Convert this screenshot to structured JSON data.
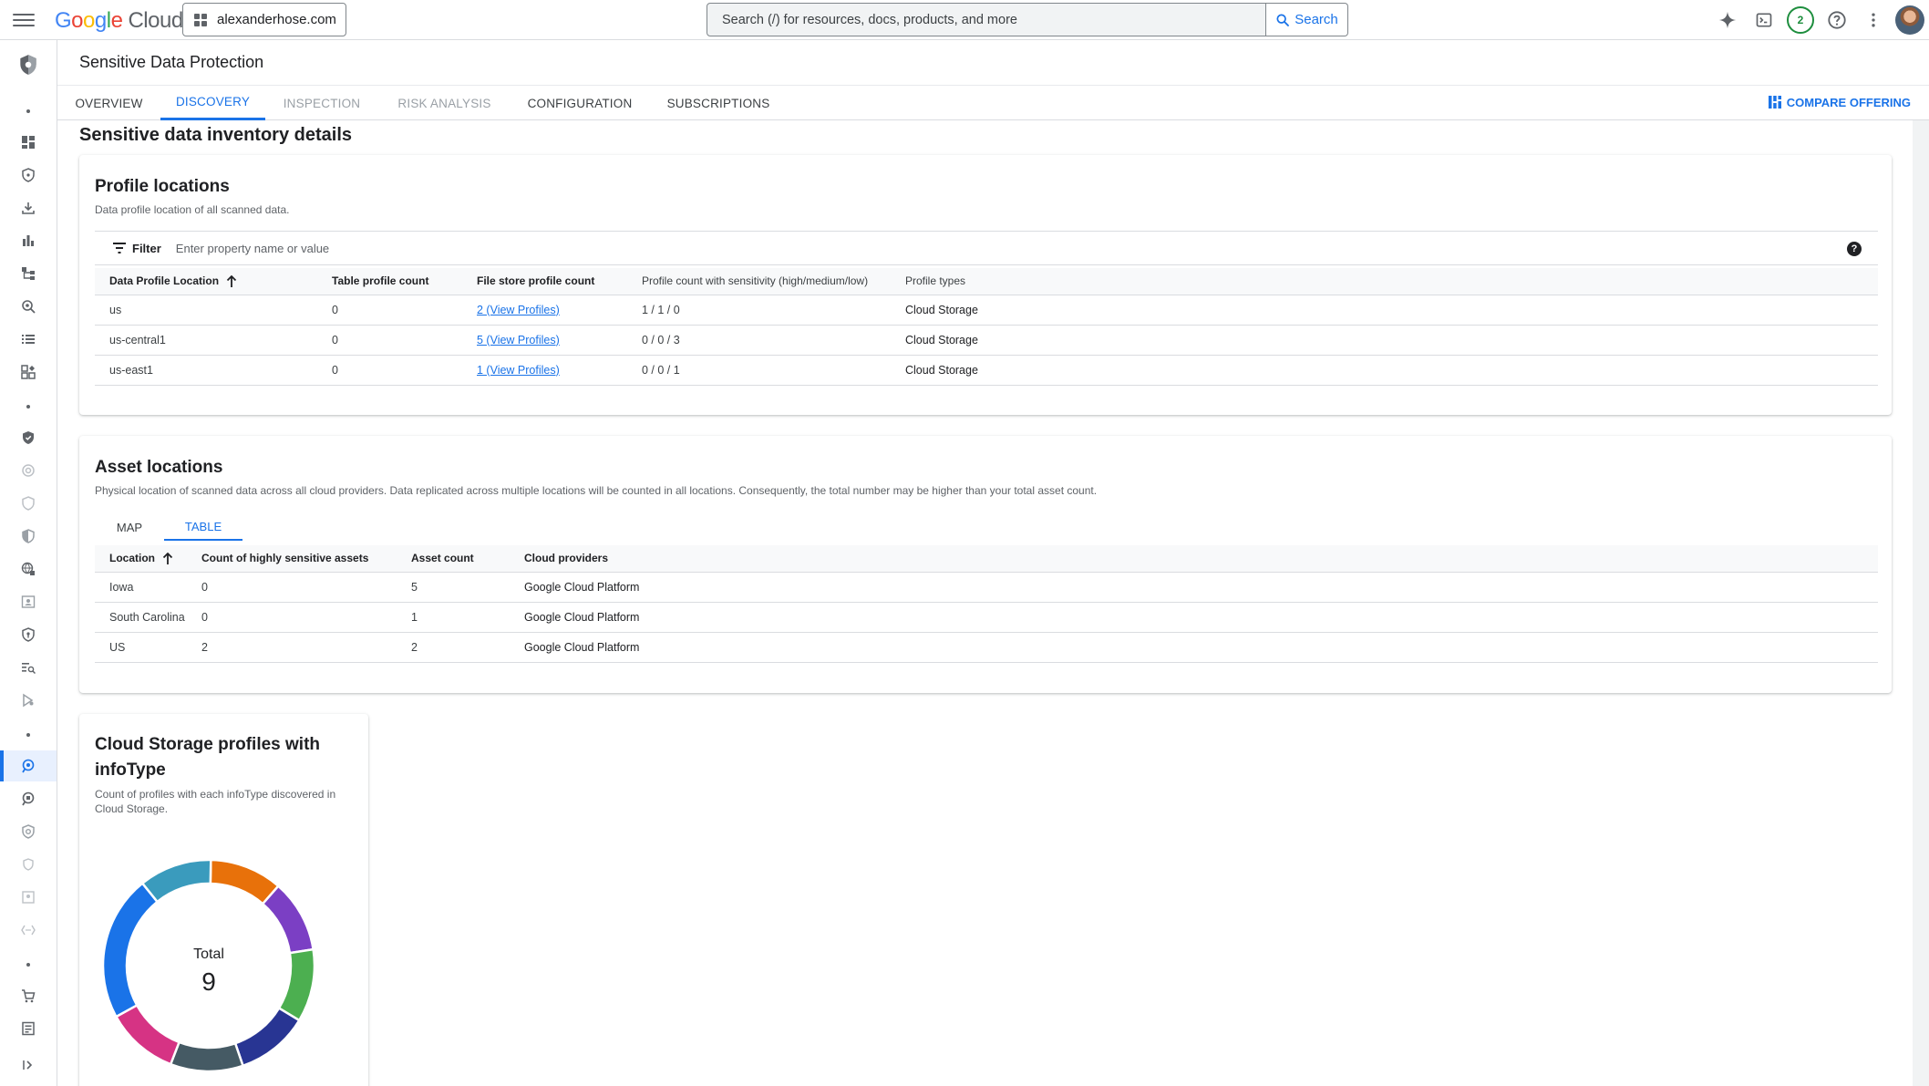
{
  "topbar": {
    "logo_google": "Google",
    "logo_cloud": "Cloud",
    "project": "alexanderhose.com",
    "search_placeholder": "Search (/) for resources, docs, products, and more",
    "search_button": "Search",
    "notification_count": "2"
  },
  "header": {
    "title": "Sensitive Data Protection"
  },
  "tabs": [
    {
      "label": "OVERVIEW",
      "state": "normal"
    },
    {
      "label": "DISCOVERY",
      "state": "active"
    },
    {
      "label": "INSPECTION",
      "state": "disabled"
    },
    {
      "label": "RISK ANALYSIS",
      "state": "disabled"
    },
    {
      "label": "CONFIGURATION",
      "state": "normal"
    },
    {
      "label": "SUBSCRIPTIONS",
      "state": "normal"
    }
  ],
  "compare_label": "COMPARE OFFERING",
  "section_title": "Sensitive data inventory details",
  "profile_locations": {
    "title": "Profile locations",
    "subtitle": "Data profile location of all scanned data.",
    "filter_label": "Filter",
    "filter_placeholder": "Enter property name or value",
    "columns": [
      "Data Profile Location",
      "Table profile count",
      "File store profile count",
      "Profile count with sensitivity (high/medium/low)",
      "Profile types"
    ],
    "rows": [
      {
        "location": "us",
        "table_count": "0",
        "file_count": "2 (View Profiles)",
        "sensitivity": "1 / 1 / 0",
        "types": "Cloud Storage"
      },
      {
        "location": "us-central1",
        "table_count": "0",
        "file_count": "5 (View Profiles)",
        "sensitivity": "0 / 0 / 3",
        "types": "Cloud Storage"
      },
      {
        "location": "us-east1",
        "table_count": "0",
        "file_count": "1 (View Profiles)",
        "sensitivity": "0 / 0 / 1",
        "types": "Cloud Storage"
      }
    ]
  },
  "asset_locations": {
    "title": "Asset locations",
    "subtitle": "Physical location of scanned data across all cloud providers. Data replicated across multiple locations will be counted in all locations. Consequently, the total number may be higher than your total asset count.",
    "subtabs": [
      "MAP",
      "TABLE"
    ],
    "columns": [
      "Location",
      "Count of highly sensitive assets",
      "Asset count",
      "Cloud providers"
    ],
    "rows": [
      {
        "location": "Iowa",
        "sensitive": "0",
        "count": "5",
        "provider": "Google Cloud Platform"
      },
      {
        "location": "South Carolina",
        "sensitive": "0",
        "count": "1",
        "provider": "Google Cloud Platform"
      },
      {
        "location": "US",
        "sensitive": "2",
        "count": "2",
        "provider": "Google Cloud Platform"
      }
    ]
  },
  "infotype_card": {
    "title_line1": "Cloud Storage profiles with",
    "title_line2": "infoType",
    "subtitle_line1": "Count of profiles with each infoType discovered in",
    "subtitle_line2": "Cloud Storage.",
    "total_label": "Total",
    "total_value": "9"
  },
  "chart_data": {
    "type": "pie",
    "values": [
      1,
      1,
      1,
      1,
      1,
      1,
      2,
      1
    ],
    "colors": [
      "#e8710a",
      "#7b3fc4",
      "#4caf50",
      "#283593",
      "#455a64",
      "#d63384",
      "#1a73e8",
      "#3a9bbd"
    ],
    "total": 9
  },
  "colors": {
    "accent": "#1a73e8"
  }
}
